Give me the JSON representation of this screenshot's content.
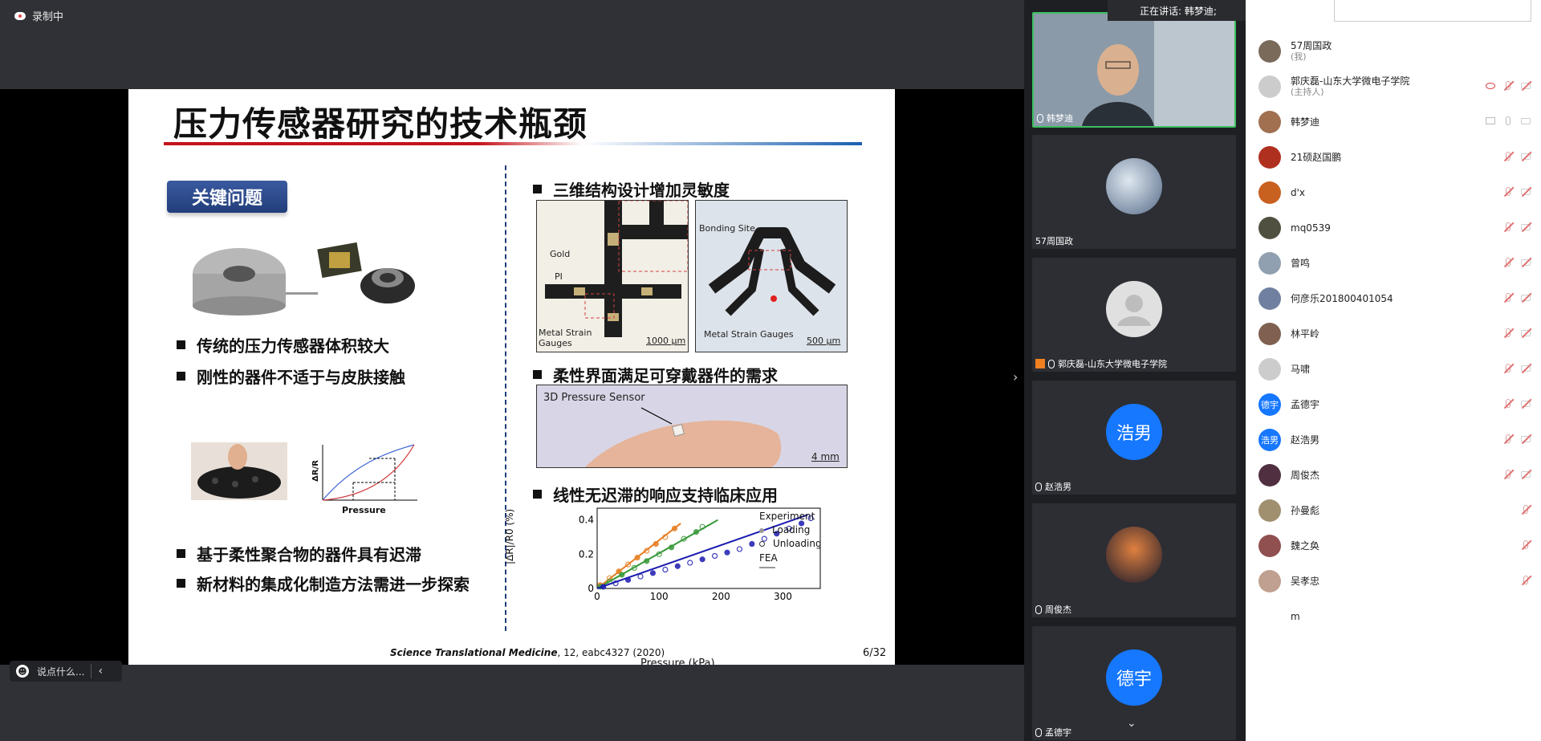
{
  "recording": {
    "label": "录制中"
  },
  "speaking": {
    "label": "正在讲话: 韩梦迪;"
  },
  "slide": {
    "title": "压力传感器研究的技术瓶颈",
    "key_badge": "关键问题",
    "left_bullets_top": [
      "传统的压力传感器体积较大",
      "刚性的器件不适于与皮肤接触"
    ],
    "left_bullets_bottom": [
      "基于柔性聚合物的器件具有迟滞",
      "新材料的集成化制造方法需进一步探索"
    ],
    "graph_small": {
      "ylabel": "ΔR/R",
      "xlabel": "Pressure"
    },
    "right_sections": [
      "三维结构设计增加灵敏度",
      "柔性界面满足可穿戴器件的需求",
      "线性无迟滞的响应支持临床应用"
    ],
    "fig1": {
      "gold": "Gold",
      "pi": "PI",
      "metal": "Metal Strain Gauges",
      "scale": "1000 μm"
    },
    "fig2": {
      "bonding": "Bonding Site",
      "metal": "Metal Strain Gauges",
      "scale": "500 μm"
    },
    "fig3": {
      "label": "3D Pressure Sensor",
      "scale": "4 mm"
    },
    "citation_journal": "Science Translational Medicine",
    "citation_rest": ", 12, eabc4327 (2020)",
    "page": "6/32"
  },
  "chart_data": {
    "type": "scatter",
    "xlabel": "Pressure (kPa)",
    "ylabel": "|ΔR|/R0 (%)",
    "xlim": [
      0,
      350
    ],
    "ylim": [
      0,
      0.45
    ],
    "xticks": [
      0,
      100,
      200,
      300
    ],
    "yticks": [
      0,
      0.2,
      0.4
    ],
    "legend": {
      "title": "Experiment",
      "loading": "Loading",
      "unloading": "Unloading",
      "fea": "FEA"
    },
    "series": [
      {
        "color": "#e67e22",
        "x": [
          5,
          20,
          35,
          50,
          65,
          80,
          95,
          110,
          125
        ],
        "y": [
          0.02,
          0.06,
          0.1,
          0.14,
          0.18,
          0.22,
          0.26,
          0.3,
          0.35
        ],
        "fea": [
          [
            0,
            0
          ],
          [
            135,
            0.38
          ]
        ]
      },
      {
        "color": "#3a9a3a",
        "x": [
          5,
          20,
          40,
          60,
          80,
          100,
          120,
          140,
          160,
          170
        ],
        "y": [
          0.01,
          0.04,
          0.08,
          0.12,
          0.16,
          0.2,
          0.24,
          0.29,
          0.33,
          0.36
        ],
        "fea": [
          [
            0,
            0
          ],
          [
            195,
            0.4
          ]
        ]
      },
      {
        "color": "#1b1bb0",
        "x": [
          10,
          30,
          50,
          70,
          90,
          110,
          130,
          150,
          170,
          190,
          210,
          230,
          250,
          270,
          290,
          310,
          330,
          345
        ],
        "y": [
          0.01,
          0.03,
          0.05,
          0.07,
          0.09,
          0.11,
          0.13,
          0.15,
          0.17,
          0.19,
          0.21,
          0.23,
          0.26,
          0.29,
          0.32,
          0.35,
          0.38,
          0.41
        ],
        "fea": [
          [
            0,
            0
          ],
          [
            340,
            0.43
          ]
        ]
      }
    ]
  },
  "videos": [
    {
      "name": "韩梦迪",
      "kind": "camera"
    },
    {
      "name": "57周国政",
      "kind": "photo"
    },
    {
      "name": "郭庆磊-山东大学微电子学院",
      "kind": "default"
    },
    {
      "name": "赵浩男",
      "kind": "text",
      "text": "浩男"
    },
    {
      "name": "周俊杰",
      "kind": "photo"
    },
    {
      "name": "孟德宇",
      "kind": "text",
      "text": "德宇"
    }
  ],
  "participants": [
    {
      "name": "57周国政",
      "sub": "(我)",
      "color": "#7a6a5a"
    },
    {
      "name": "郭庆磊-山东大学微电子学院",
      "sub": "(主持人)",
      "color": "#cccccc"
    },
    {
      "name": "韩梦迪",
      "sub": "",
      "color": "#a07050"
    },
    {
      "name": "21硕赵国鹏",
      "sub": "",
      "color": "#b03020"
    },
    {
      "name": "d'x",
      "sub": "",
      "color": "#c86020"
    },
    {
      "name": "mq0539",
      "sub": "",
      "color": "#505040"
    },
    {
      "name": "曾鸣",
      "sub": "",
      "color": "#90a0b0"
    },
    {
      "name": "何彦乐201800401054",
      "sub": "",
      "color": "#7080a0"
    },
    {
      "name": "林平岭",
      "sub": "",
      "color": "#806050"
    },
    {
      "name": "马啸",
      "sub": "",
      "color": "#cccccc"
    },
    {
      "name": "孟德宇",
      "sub": "",
      "color": "#1677ff",
      "text": "德宇"
    },
    {
      "name": "赵浩男",
      "sub": "",
      "color": "#1677ff",
      "text": "浩男"
    },
    {
      "name": "周俊杰",
      "sub": "",
      "color": "#503040"
    },
    {
      "name": "孙曼彪",
      "sub": "",
      "color": "#a09070"
    },
    {
      "name": "魏之奂",
      "sub": "",
      "color": "#905050"
    },
    {
      "name": "吴孝忠",
      "sub": "",
      "color": "#c0a090"
    },
    {
      "name": "m",
      "sub": "",
      "color": "#ffffff"
    }
  ],
  "chat": {
    "placeholder": "说点什么..."
  }
}
